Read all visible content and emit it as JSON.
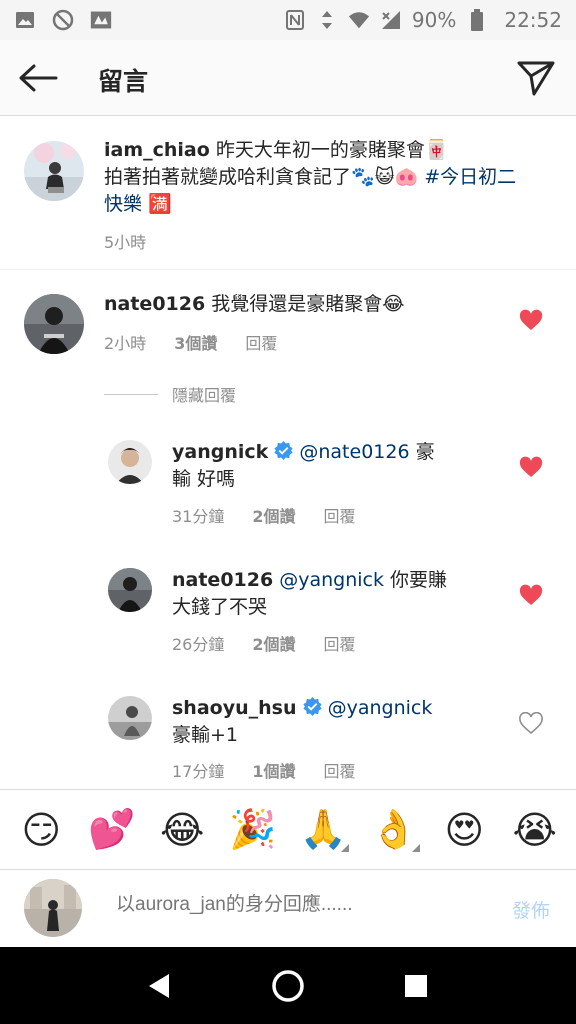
{
  "status_bar": {
    "battery": "90%",
    "time": "22:52"
  },
  "header": {
    "title": "留言"
  },
  "caption": {
    "username": "iam_chiao",
    "text_1": " 昨天大年初一的豪賭聚會",
    "emoji_1": "🀄",
    "text_2": "拍著拍著就變成哈利貪食記了",
    "emoji_2": "🐾",
    "emoji_3": "😺🐽",
    "hashtag": " #今日初二快樂",
    "emoji_4": " 🈵",
    "time": "5小時"
  },
  "comments": [
    {
      "username": "nate0126",
      "text": " 我覺得還是豪賭聚會😂",
      "time": "2小時",
      "likes": "3個讚",
      "reply": "回覆",
      "liked": true
    }
  ],
  "hidden_replies_label": "隱藏回覆",
  "replies": [
    {
      "username": "yangnick",
      "verified": true,
      "mention": "@nate0126",
      "text_line1": " 豪",
      "text_line2": "輸 好嗎",
      "time": "31分鐘",
      "likes": "2個讚",
      "reply": "回覆",
      "liked": true
    },
    {
      "username": "nate0126",
      "verified": false,
      "mention": "@yangnick",
      "text_line1": " 你要賺",
      "text_line2": "大錢了不哭",
      "time": "26分鐘",
      "likes": "2個讚",
      "reply": "回覆",
      "liked": true
    },
    {
      "username": "shaoyu_hsu",
      "verified": true,
      "mention": "@yangnick",
      "text_line1": "",
      "text_line2": "豪輸+1",
      "time": "17分鐘",
      "likes": "1個讚",
      "reply": "回覆",
      "liked": false
    }
  ],
  "emoji_bar": [
    "😏",
    "💕",
    "😂",
    "🎉",
    "🙏",
    "👌",
    "😍",
    "😭"
  ],
  "input": {
    "placeholder": "以aurora_jan的身分回應......",
    "post_label": "發佈"
  },
  "colors": {
    "heart_red": "#ed4956",
    "link_blue": "#003569",
    "verified_blue": "#3897f0",
    "muted_gray": "#8e8e8e"
  }
}
